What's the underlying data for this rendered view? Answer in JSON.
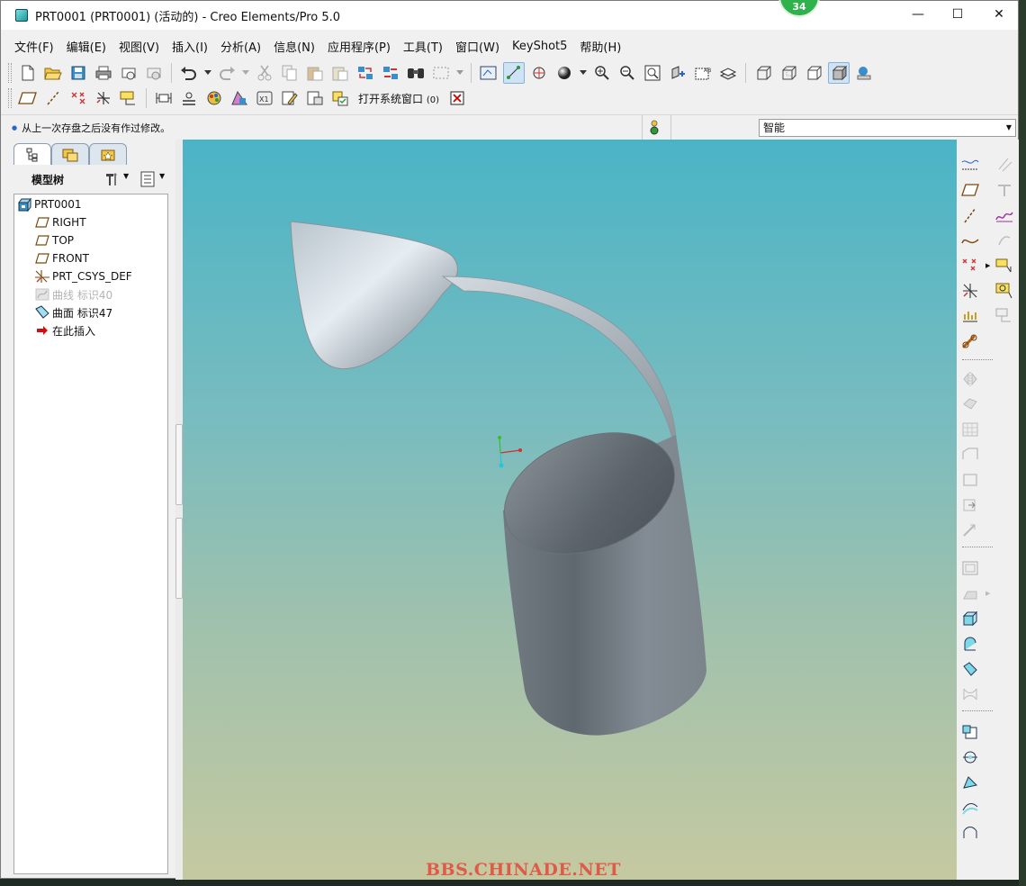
{
  "window": {
    "title": "PRT0001 (PRT0001) (活动的) - Creo Elements/Pro 5.0",
    "badge_count": "34",
    "controls": {
      "minimize": "—",
      "maximize": "☐",
      "close": "✕"
    }
  },
  "menubar": [
    "文件(F)",
    "编辑(E)",
    "视图(V)",
    "插入(I)",
    "分析(A)",
    "信息(N)",
    "应用程序(P)",
    "工具(T)",
    "窗口(W)",
    "KeyShot5",
    "帮助(H)"
  ],
  "toolbar2": {
    "open_system_window_label": "打开系统窗口",
    "open_system_window_count": "(0)"
  },
  "status": {
    "message": "从上一次存盘之后没有作过修改。",
    "filter_value": "智能"
  },
  "left_panel": {
    "tree_title": "模型树",
    "tree_items": [
      {
        "label": "PRT0001",
        "icon": "part-icon",
        "dim": false
      },
      {
        "label": "RIGHT",
        "icon": "datum-plane-icon",
        "dim": false
      },
      {
        "label": "TOP",
        "icon": "datum-plane-icon",
        "dim": false
      },
      {
        "label": "FRONT",
        "icon": "datum-plane-icon",
        "dim": false
      },
      {
        "label": "PRT_CSYS_DEF",
        "icon": "csys-icon",
        "dim": false
      },
      {
        "label": "曲线 标识40",
        "icon": "curve-icon",
        "dim": true
      },
      {
        "label": "曲面 标识47",
        "icon": "surface-icon",
        "dim": false
      },
      {
        "label": "在此插入",
        "icon": "insert-here-arrow-icon",
        "dim": false
      }
    ]
  },
  "viewport": {
    "watermark": "BBS.CHINADE.NET"
  },
  "colors": {
    "bg_top": "#4ab4c6",
    "bg_bottom": "#c5c9a0",
    "surface": "#8c939a",
    "watermark": "#e05a4a"
  }
}
